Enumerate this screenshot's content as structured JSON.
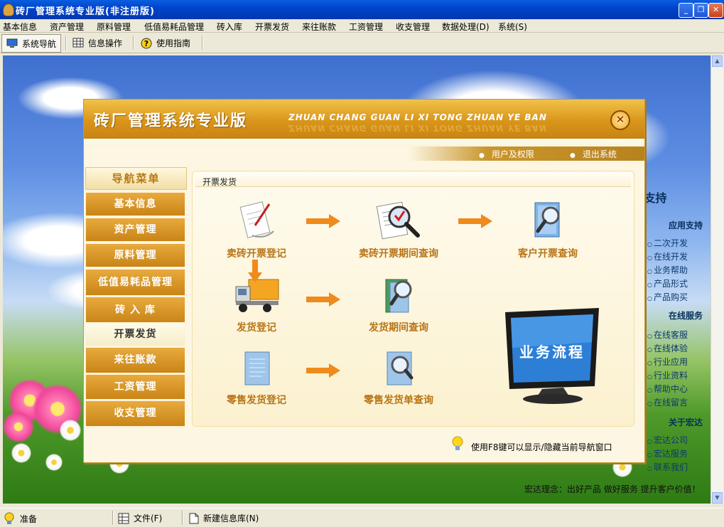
{
  "window": {
    "title": "砖厂管理系统专业版(非注册版)"
  },
  "menu": [
    "基本信息",
    "资产管理",
    "原料管理",
    "低值易耗品管理",
    "砖入库",
    "开票发货",
    "来往账款",
    "工资管理",
    "收支管理",
    "数据处理(D)",
    "系统(S)"
  ],
  "toolbar": {
    "nav": "系统导航",
    "info": "信息操作",
    "guide": "使用指南"
  },
  "dialog": {
    "title": "砖厂管理系统专业版",
    "pinyin": "ZHUAN CHANG GUAN LI XI TONG ZHUAN YE BAN",
    "links": {
      "user_rights": "用户及权限",
      "exit": "退出系统"
    },
    "nav_title": "导航菜单",
    "nav_items": [
      "基本信息",
      "资产管理",
      "原料管理",
      "低值易耗品管理",
      "砖 入 库",
      "开票发货",
      "来往账款",
      "工资管理",
      "收支管理"
    ],
    "nav_active": "开票发货",
    "section_title": "开票发货",
    "items": {
      "sale_invoice_register": "卖砖开票登记",
      "sale_invoice_query": "卖砖开票期间查询",
      "customer_invoice_query": "客户开票查询",
      "delivery_register": "发货登记",
      "delivery_query": "发货期间查询",
      "retail_register": "零售发货登记",
      "retail_query": "零售发货单查询"
    },
    "flow_label": "业务流程",
    "hint": "使用F8键可以显示/隐藏当前导航窗口"
  },
  "right_panel": {
    "partial_heading": "j支持",
    "sections": [
      {
        "heading": "应用支持",
        "items": [
          "二次开发",
          "在线开发",
          "业务帮助",
          "产品形式",
          "产品购买"
        ]
      },
      {
        "heading": "在线服务",
        "items": [
          "在线客服",
          "在线体验",
          "行业应用",
          "行业资料",
          "帮助中心",
          "在线留言"
        ]
      },
      {
        "heading": "关于宏达",
        "items": [
          "宏达公司",
          "宏达服务",
          "联系我们"
        ]
      }
    ],
    "slogan": "宏达理念：出好产品  做好服务  提升客户价值！"
  },
  "statusbar": {
    "ready": "准备",
    "file": "文件(F)",
    "new_db": "新建信息库(N)"
  },
  "colors": {
    "accent": "#c98416",
    "title_bar": "#0044cc",
    "label": "#b87415"
  }
}
